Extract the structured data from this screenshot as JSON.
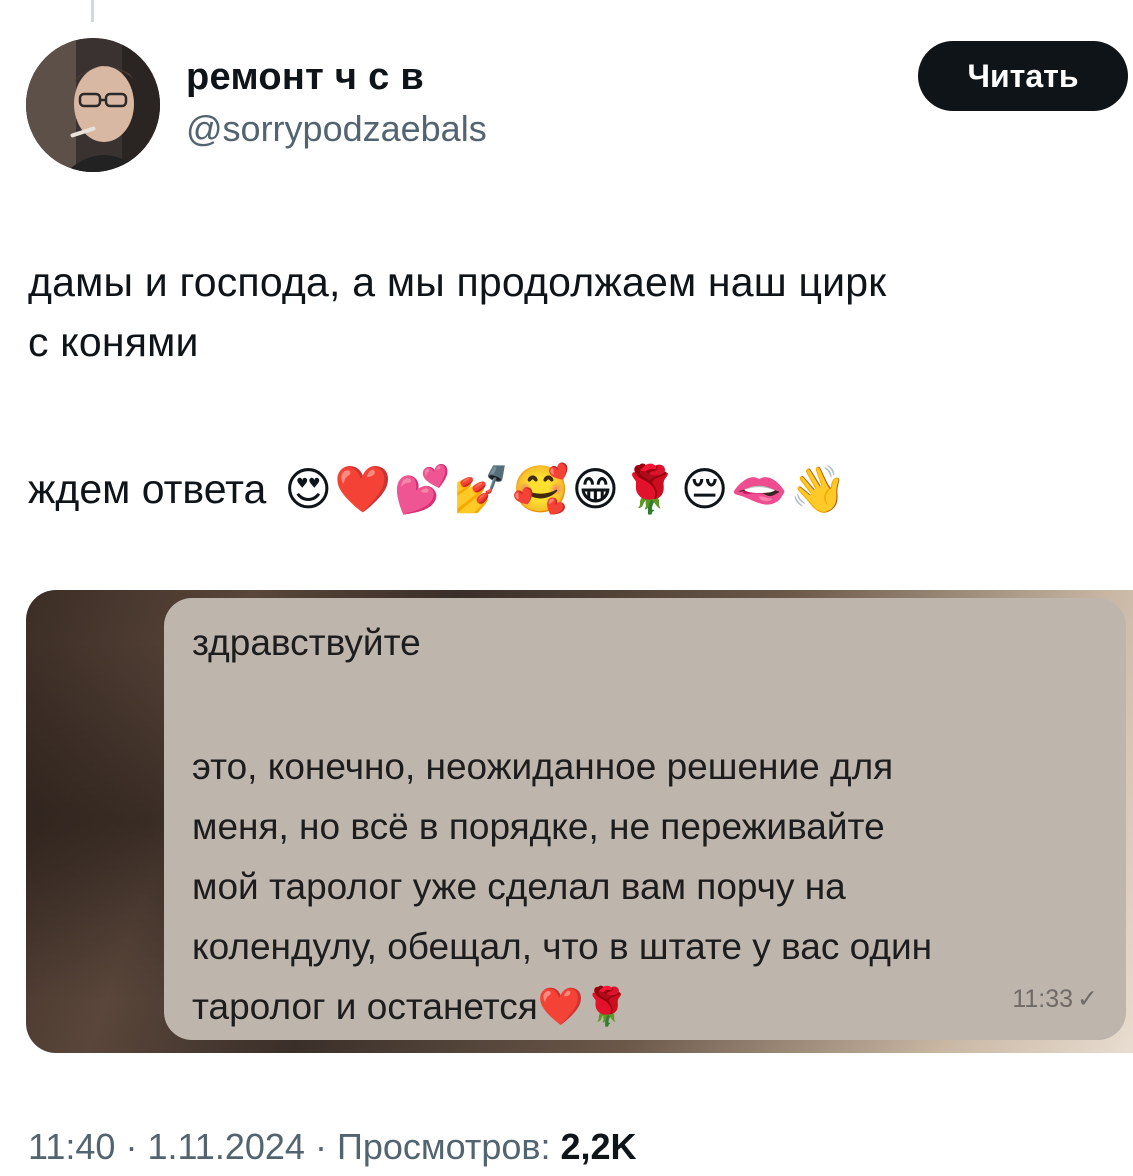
{
  "author": {
    "display_name": "ремонт ч с в",
    "handle": "@sorrypodzaebals"
  },
  "actions": {
    "read_label": "Читать"
  },
  "tweet": {
    "line1": "дамы и господа, а мы продолжаем наш цирк",
    "line2": "с конями",
    "line3": "ждем ответа",
    "emojis": [
      "😍",
      "❤️",
      "💕",
      "💅",
      "🥰",
      "😁",
      "🌹",
      "😔",
      "🫦",
      "👋"
    ]
  },
  "media": {
    "message": {
      "greeting": "здравствуйте",
      "lines": [
        "это, конечно, неожиданное решение для",
        "меня, но всё в порядке, не переживайте",
        "мой таролог уже сделал вам порчу на",
        "колендулу, обещал, что в штате у вас один",
        "таролог и останется❤️🌹"
      ],
      "time": "11:33",
      "status_icon": "✓"
    }
  },
  "meta": {
    "time": "11:40",
    "date": "1.11.2024",
    "views_label": "Просмотров:",
    "views_count": "2,2K"
  },
  "colors": {
    "text": "#0f1419",
    "secondary": "#536471",
    "button_bg": "#0f1419",
    "bubble_bg": "#beb5ad"
  }
}
